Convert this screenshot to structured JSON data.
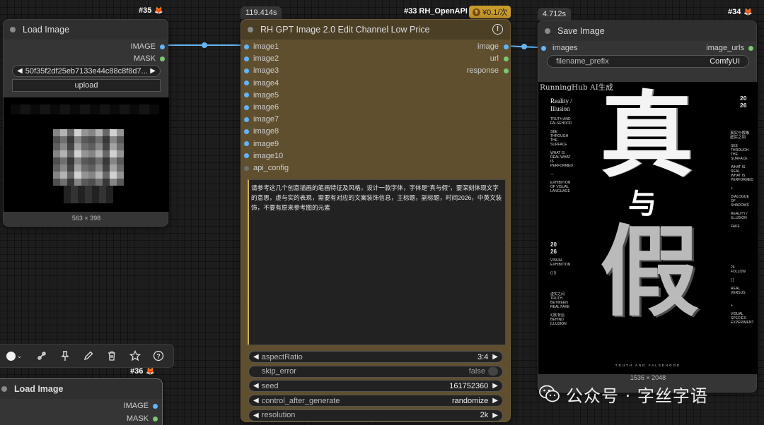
{
  "links": {
    "color": "#64b5f6"
  },
  "node35": {
    "id": "#35",
    "title": "Load Image",
    "outputs": [
      "IMAGE",
      "MASK"
    ],
    "filename": "50f35f2df25eb7133e44c88c8f8d7...",
    "upload_label": "upload",
    "dimensions": "563 × 398"
  },
  "node33": {
    "id": "#33 RH_OpenAPI",
    "time": "119.414s",
    "price": "¥0.1/次",
    "title": "RH GPT Image 2.0 Edit Channel Low Price",
    "inputs": [
      "image1",
      "image2",
      "image3",
      "image4",
      "image5",
      "image6",
      "image7",
      "image8",
      "image9",
      "image10",
      "api_config"
    ],
    "outputs": [
      "image",
      "url",
      "response"
    ],
    "prompt": "请参考这几个创意插画的笔画特征及风格，设计一款字体，字体是\"真与假\"，要深刻体现文字的意思，虚与实的表现，需要有对应的文案装饰信息，主标题，副标题，时间2026，中英文装饰，不要有原来参考图的元素",
    "widgets": [
      {
        "name": "aspectRatio",
        "value": "3:4"
      },
      {
        "name": "skip_error",
        "value": "false"
      },
      {
        "name": "seed",
        "value": "161752360"
      },
      {
        "name": "control_after_generate",
        "value": "randomize"
      },
      {
        "name": "resolution",
        "value": "2k"
      }
    ]
  },
  "node34": {
    "id": "#34",
    "time": "4.712s",
    "title": "Save Image",
    "input": "images",
    "output": "image_urls",
    "prefix_name": "filename_prefix",
    "prefix_value": "ComfyUI",
    "dimensions": "1536 × 2048",
    "watermark": "RunningHub AI生成",
    "poster": {
      "title_en": "Reality / Illusion",
      "year_top": "20 26",
      "year_mid": "20 26",
      "glyph_top": "真",
      "glyph_mid": "与",
      "glyph_bottom": "假",
      "cn_side": "真实与假象 虚实之间",
      "footer": "TRUTH AND FALSEHOOD"
    }
  },
  "node36": {
    "id": "#36",
    "title": "Load Image",
    "outputs": [
      "IMAGE",
      "MASK"
    ]
  },
  "watermark_account": "公众号 · 字丝字语"
}
